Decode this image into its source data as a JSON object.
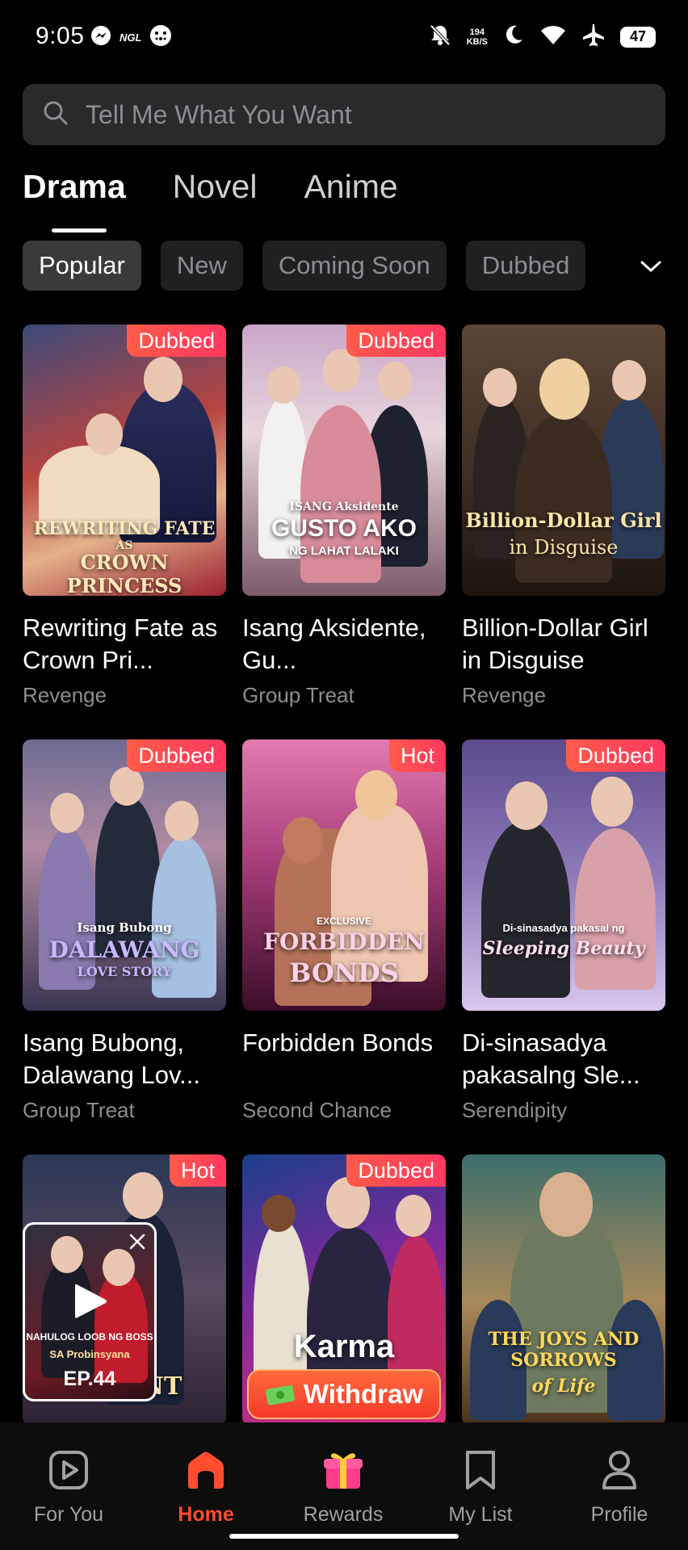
{
  "status_bar": {
    "time": "9:05",
    "ngl": "NGL",
    "speed_value": "194",
    "speed_unit": "KB/S",
    "battery": "47"
  },
  "search": {
    "placeholder": "Tell Me What You Want"
  },
  "tabs": [
    {
      "label": "Drama",
      "active": true
    },
    {
      "label": "Novel",
      "active": false
    },
    {
      "label": "Anime",
      "active": false
    }
  ],
  "chips": [
    {
      "label": "Popular",
      "active": true
    },
    {
      "label": "New",
      "active": false
    },
    {
      "label": "Coming Soon",
      "active": false
    },
    {
      "label": "Dubbed",
      "active": false
    }
  ],
  "cards": [
    {
      "badge": "Dubbed",
      "title": "Rewriting Fate as Crown Pri...",
      "genre": "Revenge",
      "poster_text": "REWRITING FATE",
      "poster_sub": "CROWN PRINCESS",
      "poster_small": "AS"
    },
    {
      "badge": "Dubbed",
      "title": "Isang Aksidente, Gu...",
      "genre": "Group Treat",
      "poster_text": "GUSTO AKO",
      "poster_sub": "NG LAHAT LALAKI",
      "poster_small": "ISANG Aksidente"
    },
    {
      "badge": "",
      "title": "Billion-Dollar Girl in Disguise",
      "genre": "Revenge",
      "poster_text": "Billion-Dollar Girl",
      "poster_sub": "in Disguise",
      "poster_small": ""
    },
    {
      "badge": "Dubbed",
      "title": "Isang Bubong, Dalawang Lov...",
      "genre": "Group Treat",
      "poster_text": "DALAWANG",
      "poster_sub": "LOVE STORY",
      "poster_small": "Isang Bubong"
    },
    {
      "badge": "Hot",
      "title": "Forbidden Bonds",
      "genre": "Second Chance",
      "poster_text": "FORBIDDEN",
      "poster_sub": "BONDS",
      "poster_small": "EXCLUSIVE"
    },
    {
      "badge": "Dubbed",
      "title": "Di-sinasadya pakasalng Sle...",
      "genre": "Serendipity",
      "poster_text": "Sleeping Beauty",
      "poster_sub": "",
      "poster_small": "Di-sinasadya pakasal ng"
    },
    {
      "badge": "Hot",
      "title": "",
      "genre": "",
      "poster_text": "ENT",
      "poster_sub": "",
      "poster_small": ""
    },
    {
      "badge": "Dubbed",
      "title": "",
      "genre": "",
      "poster_text": "Karma",
      "poster_sub": "",
      "poster_small": ""
    },
    {
      "badge": "",
      "title": "",
      "genre": "",
      "poster_text": "THE JOYS AND SORROWS",
      "poster_sub": "of Life",
      "poster_small": ""
    }
  ],
  "mini_player": {
    "title": "NAHULOG LOOB NG BOSS",
    "subtitle": "SA Probinsyana",
    "episode": "EP.44"
  },
  "withdraw_label": "Withdraw",
  "nav": [
    {
      "label": "For You",
      "active": false
    },
    {
      "label": "Home",
      "active": true
    },
    {
      "label": "Rewards",
      "active": false
    },
    {
      "label": "My List",
      "active": false
    },
    {
      "label": "Profile",
      "active": false
    }
  ],
  "colors": {
    "accent": "#ff4d2e",
    "badge": "#ff3b5c",
    "background": "#000000"
  }
}
